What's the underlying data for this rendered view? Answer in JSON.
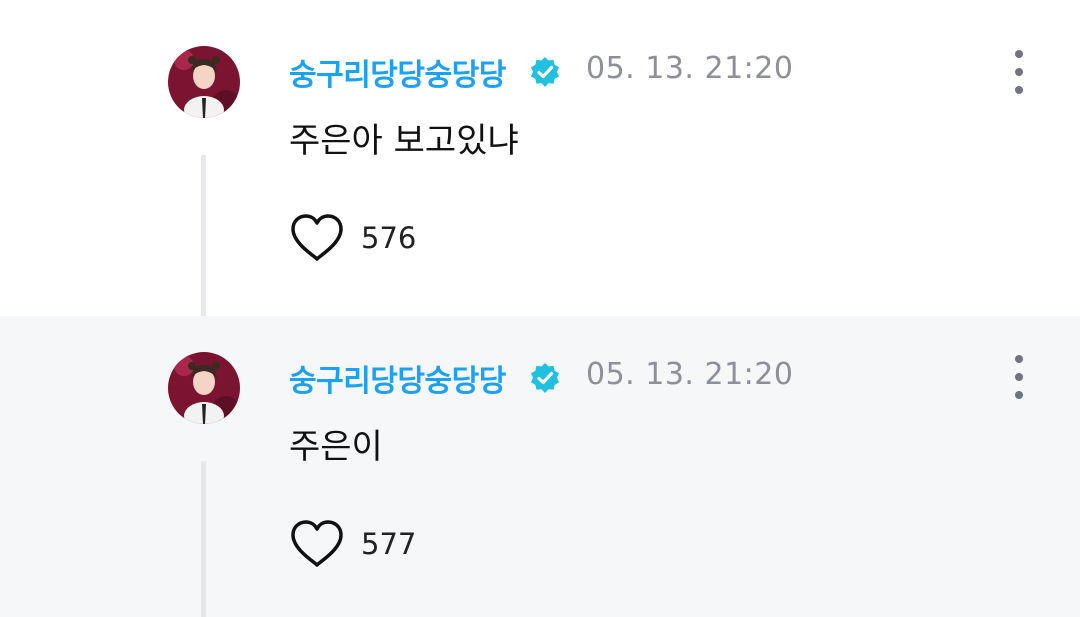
{
  "colors": {
    "author": "#1da1f2",
    "verified_badge": "#21c0e0",
    "timestamp": "#8d9099",
    "highlight_bg": "#f6f7f9",
    "thread_line": "#e7e8ec"
  },
  "comments": [
    {
      "author": "숭구리당당숭당당",
      "verified": true,
      "time": "05. 13. 21:20",
      "text": "주은아 보고있냐",
      "likes": "576",
      "icons": [
        "avatar",
        "verified-check-icon",
        "more-vertical-icon",
        "heart-outline-icon"
      ]
    },
    {
      "author": "숭구리당당숭당당",
      "verified": true,
      "time": "05. 13. 21:20",
      "text": "주은이",
      "likes": "577",
      "icons": [
        "avatar",
        "verified-check-icon",
        "more-vertical-icon",
        "heart-outline-icon"
      ]
    }
  ]
}
